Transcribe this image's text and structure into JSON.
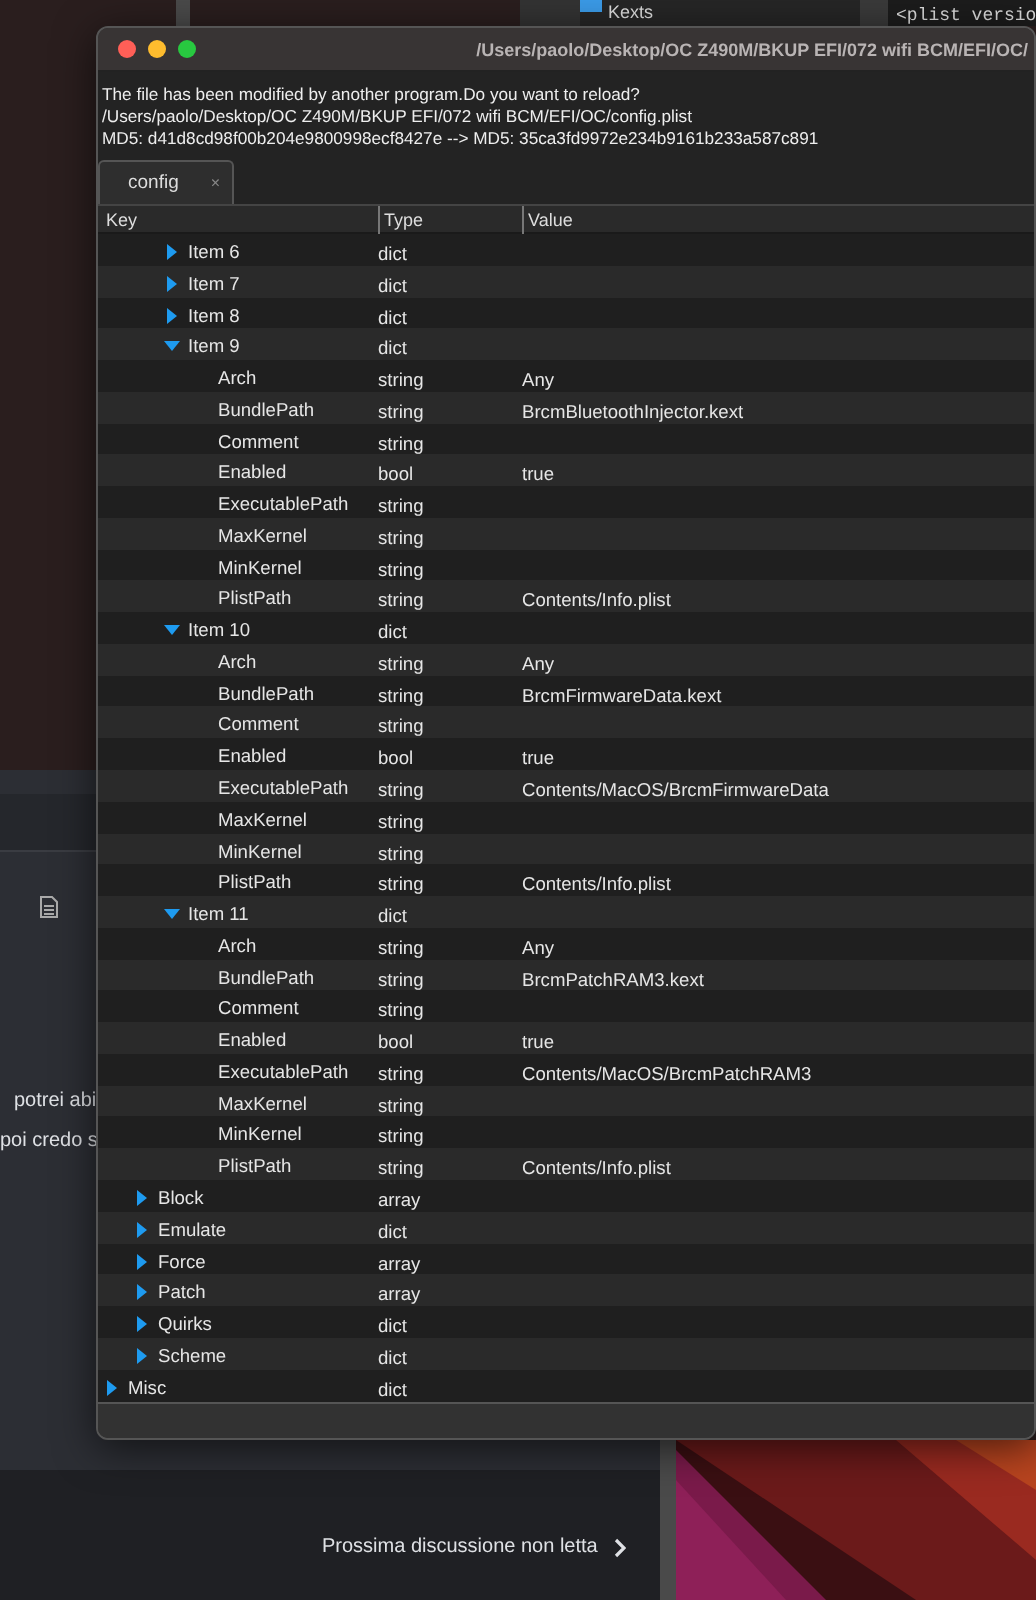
{
  "window": {
    "title": "/Users/paolo/Desktop/OC Z490M/BKUP EFI/072 wifi BCM/EFI/OC/"
  },
  "message": [
    "The file has been modified by another program.Do you want to reload?",
    "/Users/paolo/Desktop/OC Z490M/BKUP EFI/072 wifi BCM/EFI/OC/config.plist",
    "MD5: d41d8cd98f00b204e9800998ecf8427e  -->  MD5: 35ca3fd9972e234b9161b233a587c891"
  ],
  "tabs": [
    {
      "label": "config",
      "selected": true,
      "close": "×"
    }
  ],
  "columns": [
    "Key",
    "Type",
    "Value"
  ],
  "tree": [
    {
      "children": [
        {
          "children": [
            {
              "key": "Item 6",
              "type": "dict",
              "expanded": false
            },
            {
              "key": "Item 7",
              "type": "dict",
              "expanded": false
            },
            {
              "key": "Item 8",
              "type": "dict",
              "expanded": false
            },
            {
              "key": "Item 9",
              "type": "dict",
              "expanded": true,
              "children": [
                {
                  "key": "Arch",
                  "type": "string",
                  "value": "Any"
                },
                {
                  "key": "BundlePath",
                  "type": "string",
                  "value": "BrcmBluetoothInjector.kext"
                },
                {
                  "key": "Comment",
                  "type": "string"
                },
                {
                  "key": "Enabled",
                  "type": "bool",
                  "value": "true"
                },
                {
                  "key": "ExecutablePath",
                  "type": "string"
                },
                {
                  "key": "MaxKernel",
                  "type": "string"
                },
                {
                  "key": "MinKernel",
                  "type": "string"
                },
                {
                  "key": "PlistPath",
                  "type": "string",
                  "value": "Contents/Info.plist"
                }
              ]
            },
            {
              "key": "Item 10",
              "type": "dict",
              "expanded": true,
              "children": [
                {
                  "key": "Arch",
                  "type": "string",
                  "value": "Any"
                },
                {
                  "key": "BundlePath",
                  "type": "string",
                  "value": "BrcmFirmwareData.kext"
                },
                {
                  "key": "Comment",
                  "type": "string"
                },
                {
                  "key": "Enabled",
                  "type": "bool",
                  "value": "true"
                },
                {
                  "key": "ExecutablePath",
                  "type": "string",
                  "value": "Contents/MacOS/BrcmFirmwareData"
                },
                {
                  "key": "MaxKernel",
                  "type": "string"
                },
                {
                  "key": "MinKernel",
                  "type": "string"
                },
                {
                  "key": "PlistPath",
                  "type": "string",
                  "value": "Contents/Info.plist"
                }
              ]
            },
            {
              "key": "Item 11",
              "type": "dict",
              "expanded": true,
              "children": [
                {
                  "key": "Arch",
                  "type": "string",
                  "value": "Any"
                },
                {
                  "key": "BundlePath",
                  "type": "string",
                  "value": "BrcmPatchRAM3.kext"
                },
                {
                  "key": "Comment",
                  "type": "string"
                },
                {
                  "key": "Enabled",
                  "type": "bool",
                  "value": "true"
                },
                {
                  "key": "ExecutablePath",
                  "type": "string",
                  "value": "Contents/MacOS/BrcmPatchRAM3"
                },
                {
                  "key": "MaxKernel",
                  "type": "string"
                },
                {
                  "key": "MinKernel",
                  "type": "string"
                },
                {
                  "key": "PlistPath",
                  "type": "string",
                  "value": "Contents/Info.plist"
                }
              ]
            }
          ]
        },
        {
          "key": "Block",
          "type": "array",
          "expanded": false
        },
        {
          "key": "Emulate",
          "type": "dict",
          "expanded": false
        },
        {
          "key": "Force",
          "type": "array",
          "expanded": false
        },
        {
          "key": "Patch",
          "type": "array",
          "expanded": false
        },
        {
          "key": "Quirks",
          "type": "dict",
          "expanded": false
        },
        {
          "key": "Scheme",
          "type": "dict",
          "expanded": false
        }
      ]
    },
    {
      "key": "Misc",
      "type": "dict",
      "expanded": false
    }
  ],
  "background": {
    "finder_item": "Kexts",
    "code_line": "<plist versio",
    "forum_lines": [
      "potrei abi",
      "poi credo s"
    ],
    "next_link": "Prossima discussione non letta"
  }
}
